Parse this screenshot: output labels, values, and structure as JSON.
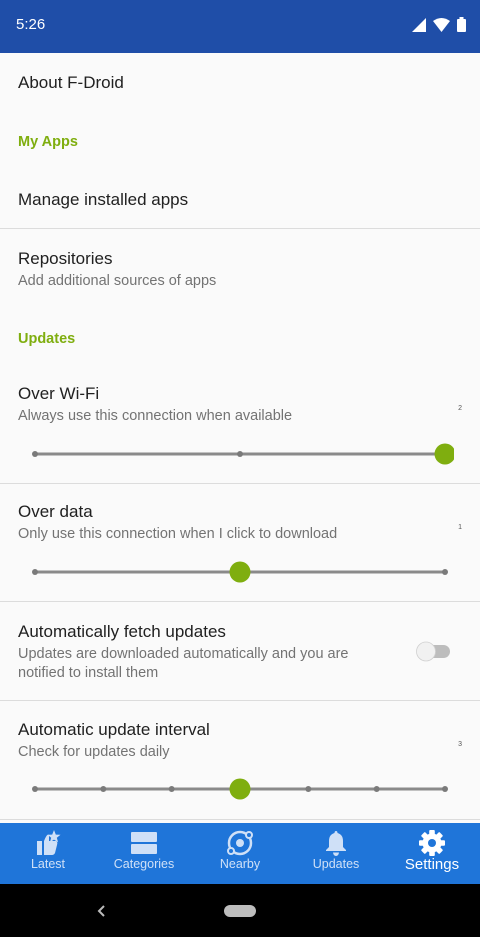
{
  "status_bar": {
    "time": "5:26"
  },
  "items": {
    "about": {
      "title": "About F-Droid"
    },
    "section_my_apps": {
      "label": "My Apps"
    },
    "manage": {
      "title": "Manage installed apps"
    },
    "repos": {
      "title": "Repositories",
      "summary": "Add additional sources of apps"
    },
    "section_updates": {
      "label": "Updates"
    },
    "over_wifi": {
      "title": "Over Wi-Fi",
      "summary": "Always use this connection when available",
      "value": "2",
      "level": 2,
      "max": 2
    },
    "over_data": {
      "title": "Over data",
      "summary": "Only use this connection when I click to download",
      "value": "1",
      "level": 1,
      "max": 2
    },
    "auto_fetch": {
      "title": "Automatically fetch updates",
      "summary": "Updates are downloaded automatically and you are notified to install them",
      "enabled": false
    },
    "interval": {
      "title": "Automatic update interval",
      "summary": "Check for updates daily",
      "value": "3",
      "level": 3,
      "max": 6
    }
  },
  "bottom_nav": {
    "latest": "Latest",
    "categories": "Categories",
    "nearby": "Nearby",
    "updates": "Updates",
    "settings": "Settings",
    "active": "settings"
  },
  "colors": {
    "accent": "#7fae0f",
    "nav_bg": "#1f75d9",
    "status_bg": "#1f4ea8"
  },
  "icons": [
    "signal-icon",
    "wifi-icon",
    "battery-icon",
    "star-badge-icon",
    "categories-icon",
    "nearby-icon",
    "bell-icon",
    "gear-icon",
    "back-icon",
    "home-pill-icon"
  ]
}
